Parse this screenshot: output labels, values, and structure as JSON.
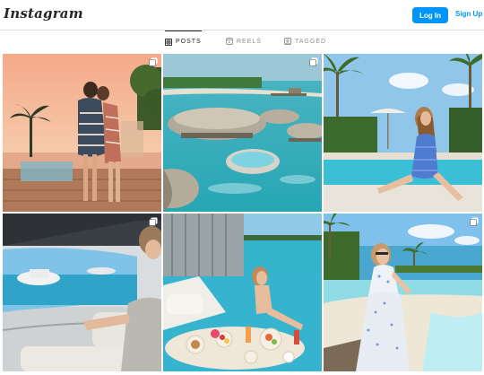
{
  "header": {
    "logo_text": "Instagram",
    "login_label": "Log In",
    "signup_label": "Sign Up"
  },
  "tabs": [
    {
      "label": "POSTS",
      "icon": "grid-icon",
      "active": true
    },
    {
      "label": "REELS",
      "icon": "reels-icon",
      "active": false
    },
    {
      "label": "TAGGED",
      "icon": "tagged-icon",
      "active": false
    }
  ],
  "posts": [
    {
      "subject": "couple in robes at sunset",
      "multi": true
    },
    {
      "subject": "overwater villas aerial",
      "multi": true
    },
    {
      "subject": "woman in blue dress by pool",
      "multi": false
    },
    {
      "subject": "yacht cabin with sea view",
      "multi": true
    },
    {
      "subject": "floating breakfast at villa pool",
      "multi": false
    },
    {
      "subject": "woman in white dress on beach",
      "multi": true
    }
  ],
  "colors": {
    "accent": "#0095f6",
    "border": "#dbdbdb",
    "muted": "#8e8e8e"
  }
}
